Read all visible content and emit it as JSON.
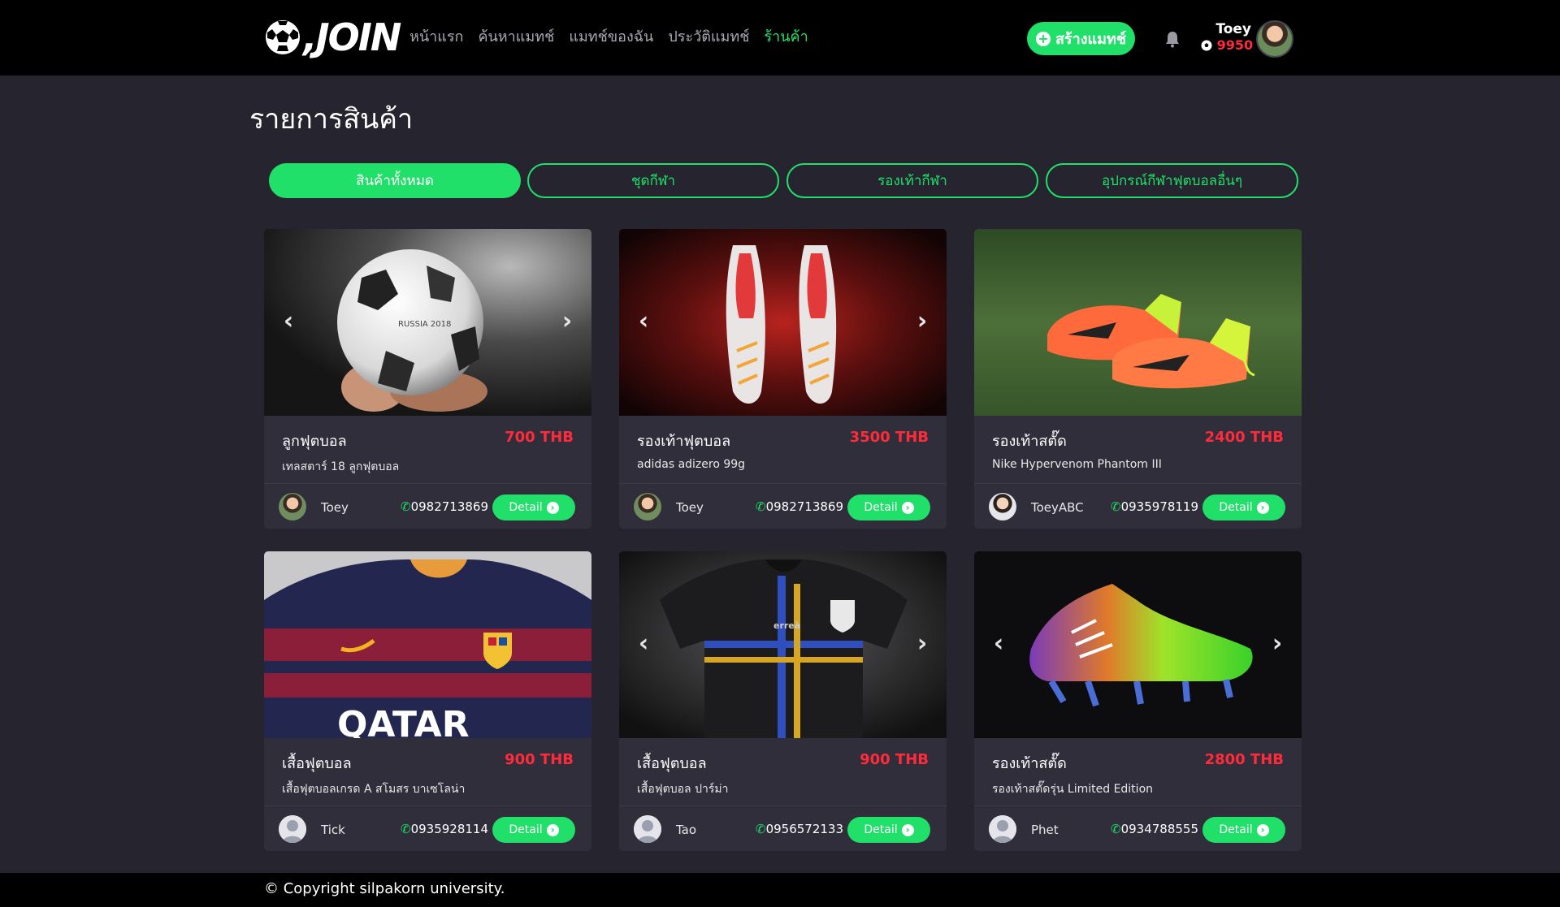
{
  "nav": {
    "logo_text": "JOIN",
    "links": [
      "หน้าแรก",
      "ค้นหาแมทช์",
      "แมทช์ของฉัน",
      "ประวัติแมทช์",
      "ร้านค้า"
    ],
    "active_link": "ร้านค้า",
    "create_match_label": "สร้างแมทช์",
    "user": {
      "name": "Toey",
      "points": "9950"
    }
  },
  "page": {
    "title": "รายการสินค้า",
    "tabs": [
      {
        "label": "สินค้าทั้งหมด",
        "active": true
      },
      {
        "label": "ชุดกีฬา",
        "active": false
      },
      {
        "label": "รองเท้ากีฬา",
        "active": false
      },
      {
        "label": "อุปกรณ์กีฬาฟุตบอลอื่นๆ",
        "active": false
      }
    ]
  },
  "products": [
    {
      "name": "ลูกฟุตบอล",
      "price": "700 THB",
      "description": "เทลสตาร์ 18 ลูกฟุตบอล",
      "seller": "Toey",
      "phone": "0982713869",
      "detail_label": "Detail",
      "image": "football-ball",
      "has_carousel_arrows": true
    },
    {
      "name": "รองเท้าฟุตบอล",
      "price": "3500 THB",
      "description": "adidas adizero 99g",
      "seller": "Toey",
      "phone": "0982713869",
      "detail_label": "Detail",
      "image": "red-boots",
      "has_carousel_arrows": true
    },
    {
      "name": "รองเท้าสตั๊ด",
      "price": "2400 THB",
      "description": "Nike Hypervenom Phantom III",
      "seller": "ToeyABC",
      "phone": "0935978119",
      "detail_label": "Detail",
      "image": "green-orange-boots",
      "has_carousel_arrows": false
    },
    {
      "name": "เสื้อฟุตบอล",
      "price": "900 THB",
      "description": "เสื้อฟุตบอลเกรด A สโมสร บาเซโลน่า",
      "seller": "Tick",
      "phone": "0935928114",
      "detail_label": "Detail",
      "image": "barcelona-jersey",
      "has_carousel_arrows": false
    },
    {
      "name": "เสื้อฟุตบอล",
      "price": "900 THB",
      "description": "เสื้อฟุตบอล ปาร์ม่า",
      "seller": "Tao",
      "phone": "0956572133",
      "detail_label": "Detail",
      "image": "parma-jersey",
      "has_carousel_arrows": true
    },
    {
      "name": "รองเท้าสตั๊ด",
      "price": "2800 THB",
      "description": "รองเท้าสตั๊ดรุ่น Limited Edition",
      "seller": "Phet",
      "phone": "0934788555",
      "detail_label": "Detail",
      "image": "limited-boot",
      "has_carousel_arrows": true
    }
  ],
  "footer": {
    "copyright": "© Copyright silpakorn university."
  },
  "colors": {
    "accent": "#21e06a",
    "price": "#ff2b3b",
    "background": "#25242f",
    "card": "#2f2e3a",
    "navbar": "#000000"
  }
}
